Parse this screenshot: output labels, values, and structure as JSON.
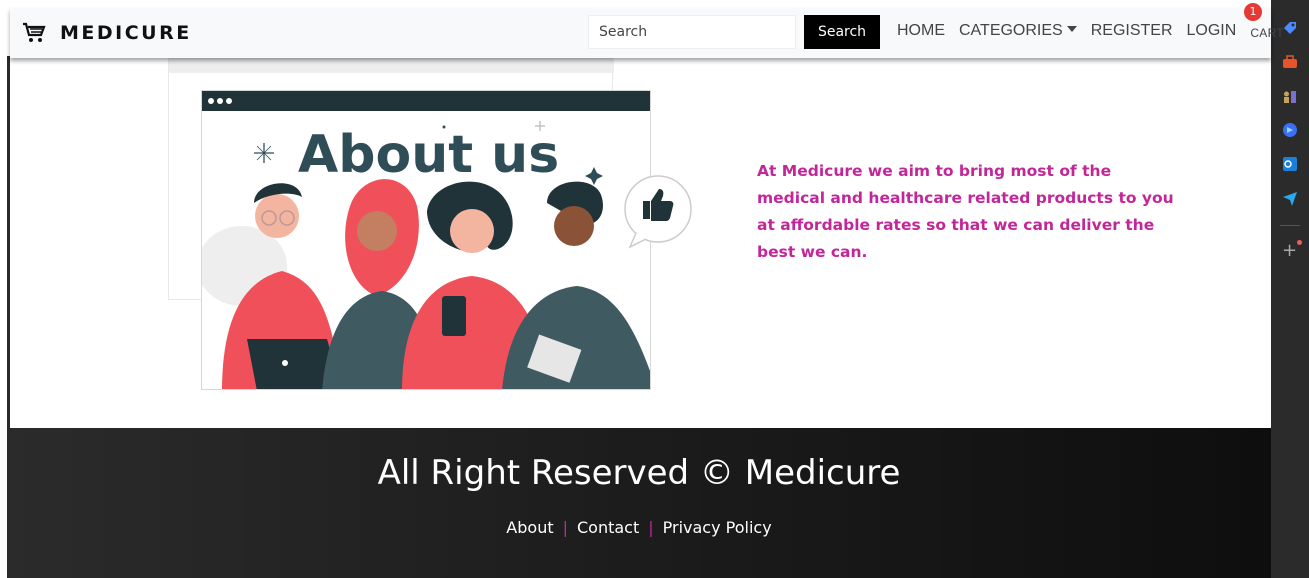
{
  "navbar": {
    "brand": "MEDICURE",
    "search_placeholder": "Search",
    "search_button": "Search",
    "links": {
      "home": "HOME",
      "categories": "CATEGORIES",
      "register": "REGISTER",
      "login": "LOGIN",
      "cart": "CART"
    },
    "cart_count": "1"
  },
  "main": {
    "illustration_title": "About us",
    "about_text": "At Medicure we aim to bring most of the medical and healthcare related products to you at affordable rates so that we can deliver the best we can."
  },
  "footer": {
    "title": "All Right Reserved © Medicure",
    "links": [
      "About",
      "Contact",
      "Privacy Policy"
    ]
  },
  "colors": {
    "accent": "#c2279a",
    "footer_bg": "#1c1c1c",
    "badge": "#e53935",
    "illustration_dark": "#2f4d57",
    "illustration_red": "#f0505a"
  },
  "sidebar_icons": [
    "tag-icon",
    "briefcase-icon",
    "chess-icon",
    "copilot-icon",
    "outlook-icon",
    "send-icon",
    "add-icon"
  ]
}
